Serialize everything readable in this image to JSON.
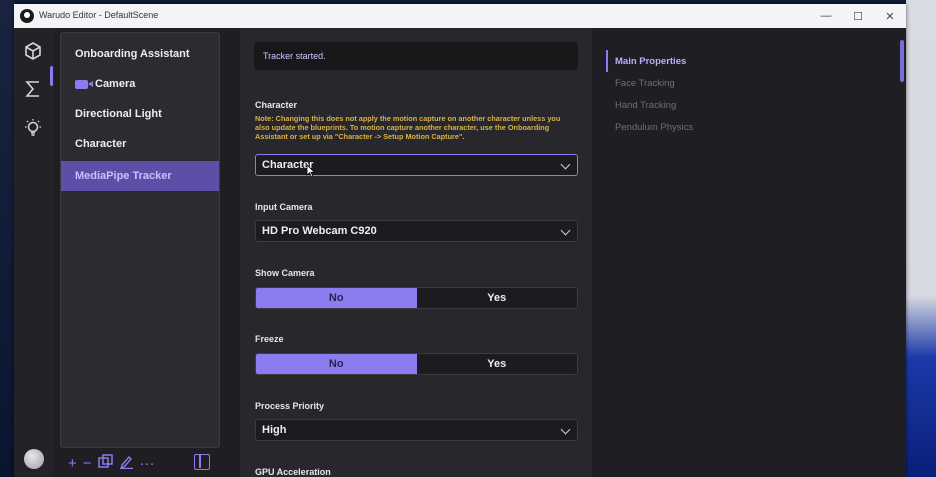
{
  "window": {
    "title": "Warudo Editor - DefaultScene",
    "minimize": "—",
    "maximize": "☐",
    "close": "✕"
  },
  "rail": {
    "icons": [
      "cube-icon",
      "sigma-icon",
      "lightbulb-icon"
    ],
    "active": "cube-icon"
  },
  "scene": {
    "items": [
      {
        "label": "Onboarding Assistant"
      },
      {
        "label": "Camera"
      },
      {
        "label": "Directional Light"
      },
      {
        "label": "Character"
      },
      {
        "label": "MediaPipe Tracker"
      }
    ],
    "tools": {
      "add": "+",
      "remove": "−",
      "more": "···"
    }
  },
  "props": {
    "status": "Tracker started.",
    "character": {
      "label": "Character",
      "note": "Note: Changing this does not apply the motion capture on another character unless you also update the blueprints. To motion capture another character, use the Onboarding Assistant or set up via \"Character -> Setup Motion Capture\".",
      "value": "Character"
    },
    "input_camera": {
      "label": "Input Camera",
      "value": "HD Pro Webcam C920"
    },
    "show_camera": {
      "label": "Show Camera",
      "no": "No",
      "yes": "Yes",
      "selected": "No"
    },
    "freeze": {
      "label": "Freeze",
      "no": "No",
      "yes": "Yes",
      "selected": "No"
    },
    "process_priority": {
      "label": "Process Priority",
      "value": "High"
    },
    "gpu_accel": {
      "label": "GPU Acceleration"
    }
  },
  "toc": {
    "items": [
      {
        "label": "Main Properties"
      },
      {
        "label": "Face Tracking"
      },
      {
        "label": "Hand Tracking"
      },
      {
        "label": "Pendulum Physics"
      }
    ],
    "active": "Main Properties"
  },
  "colors": {
    "accent": "#8b7cf0",
    "panel": "#27272c",
    "note": "#d9b24a"
  }
}
